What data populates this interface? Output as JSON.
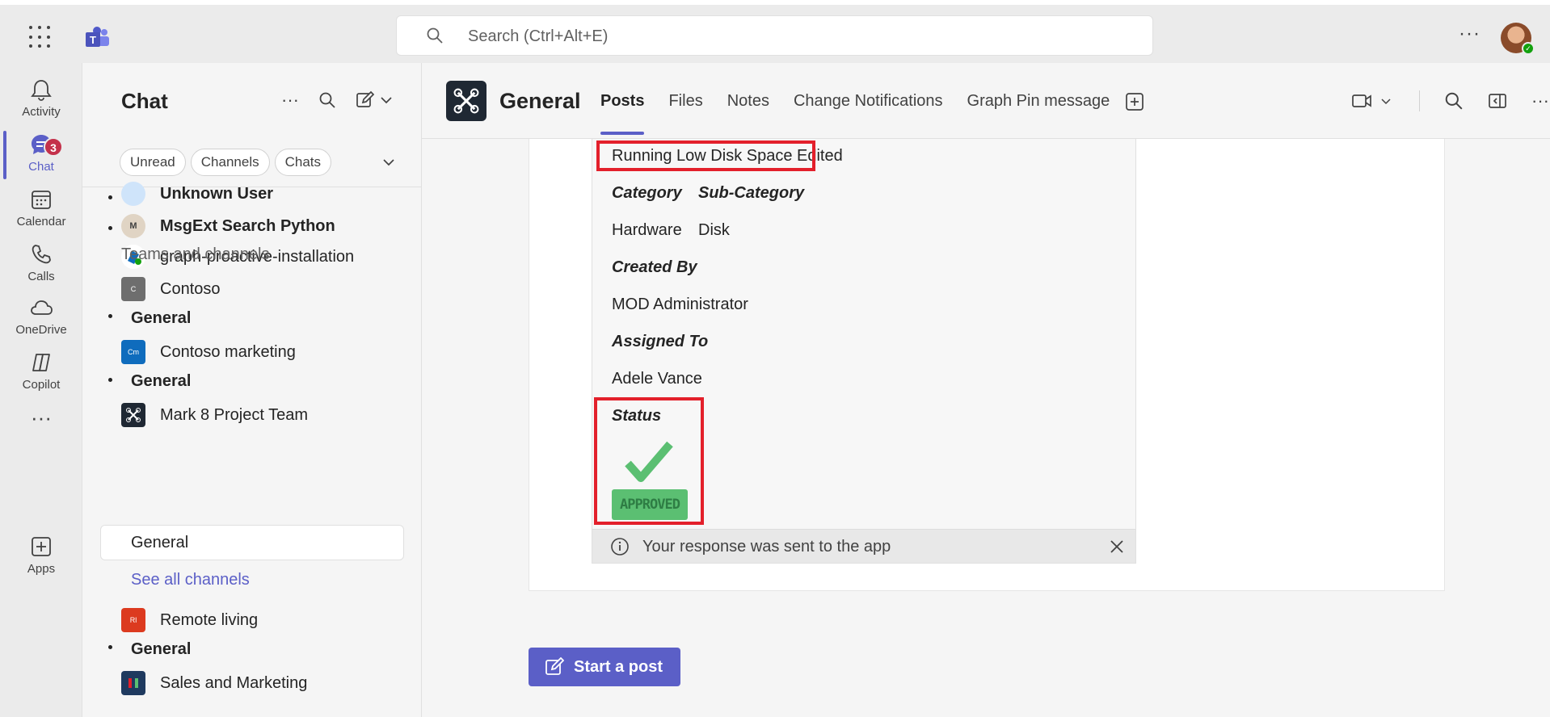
{
  "app": {
    "search_placeholder": "Search (Ctrl+Alt+E)"
  },
  "rail": {
    "items": [
      {
        "label": "Activity",
        "icon": "bell-icon"
      },
      {
        "label": "Chat",
        "icon": "chat-icon",
        "badge": "3"
      },
      {
        "label": "Calendar",
        "icon": "calendar-icon"
      },
      {
        "label": "Calls",
        "icon": "phone-icon"
      },
      {
        "label": "OneDrive",
        "icon": "cloud-icon"
      },
      {
        "label": "Copilot",
        "icon": "copilot-icon"
      },
      {
        "label": "Apps",
        "icon": "plus-icon"
      }
    ]
  },
  "panel": {
    "title": "Chat",
    "filters": [
      "Unread",
      "Channels",
      "Chats"
    ],
    "chats": [
      {
        "name": "Unknown User"
      },
      {
        "name": "MsgExt Search Python"
      },
      {
        "name": "graph-proactive-installation"
      }
    ],
    "section_label": "Teams and channels",
    "teams": [
      {
        "name": "Contoso",
        "abbr": "C",
        "color": "#6e6e6e",
        "channel": "General"
      },
      {
        "name": "Contoso marketing",
        "abbr": "Cm",
        "color": "#0f6cbd",
        "channel": "General"
      },
      {
        "name": "Mark 8 Project Team",
        "abbr": "",
        "color": "#1f2833",
        "channel": "General"
      },
      {
        "name": "Remote living",
        "abbr": "Rl",
        "color": "#dc3a1f",
        "channel": "General"
      },
      {
        "name": "Sales and Marketing",
        "abbr": "",
        "color": "#1f3a5f",
        "channel": ""
      }
    ],
    "see_all": "See all channels"
  },
  "channel": {
    "name": "General",
    "tabs": [
      "Posts",
      "Files",
      "Notes",
      "Change Notifications",
      "Graph Pin message"
    ]
  },
  "card": {
    "title": "Running Low Disk Space Edited",
    "category_label": "Category",
    "subcategory_label": "Sub-Category",
    "category": "Hardware",
    "subcategory": "Disk",
    "created_by_label": "Created By",
    "created_by": "MOD Administrator",
    "assigned_to_label": "Assigned To",
    "assigned_to": "Adele Vance",
    "status_label": "Status",
    "status_badge": "APPROVED",
    "response_note": "Your response was sent to the app"
  },
  "compose": {
    "start_post": "Start a post"
  },
  "colors": {
    "accent": "#5b5fc7",
    "highlight": "#e3202b",
    "approved": "#5bbf72"
  }
}
